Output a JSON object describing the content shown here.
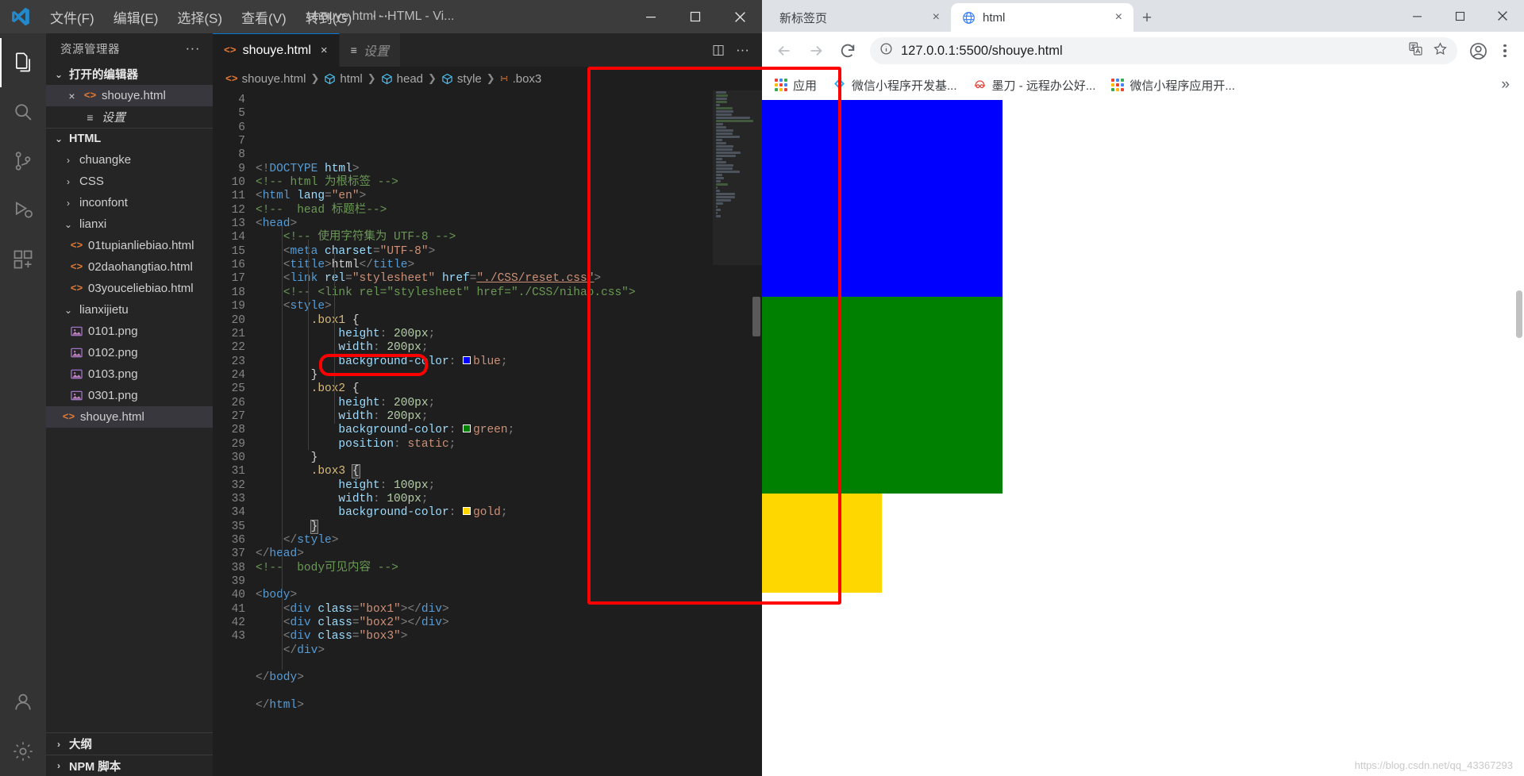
{
  "vscode": {
    "window_title": "shouye.html - HTML - Vi...",
    "menu": [
      "文件(F)",
      "编辑(E)",
      "选择(S)",
      "查看(V)",
      "转到(G)"
    ],
    "menu_overflow": "···",
    "window_buttons": {
      "minimize": "minimize",
      "maximize": "maximize",
      "close": "close"
    },
    "activity_bar": [
      {
        "name": "explorer",
        "icon": "files-icon",
        "active": true
      },
      {
        "name": "search",
        "icon": "search-icon",
        "active": false
      },
      {
        "name": "source-control",
        "icon": "source-control-icon",
        "active": false
      },
      {
        "name": "run-debug",
        "icon": "run-debug-icon",
        "active": false
      },
      {
        "name": "extensions",
        "icon": "extensions-icon",
        "active": false
      },
      {
        "name": "accounts",
        "icon": "account-icon",
        "active": false
      },
      {
        "name": "settings",
        "icon": "gear-icon",
        "active": false
      }
    ],
    "sidebar": {
      "header": "资源管理器",
      "header_more": "···",
      "open_editors": {
        "label": "打开的编辑器",
        "chevron": "⌄",
        "items": [
          {
            "label": "shouye.html",
            "icon": "html-file-icon",
            "close": "×",
            "selected": true,
            "italic": false
          },
          {
            "label": "设置",
            "icon": "settings-editor-icon",
            "close": "",
            "selected": false,
            "italic": true
          }
        ]
      },
      "project": {
        "label": "HTML",
        "chevron": "⌄",
        "items": [
          {
            "label": "chuangke",
            "type": "folder",
            "chevron": "›",
            "depth": 1,
            "selected": false
          },
          {
            "label": "CSS",
            "type": "folder",
            "chevron": "›",
            "depth": 1,
            "selected": false
          },
          {
            "label": "inconfont",
            "type": "folder",
            "chevron": "›",
            "depth": 1,
            "selected": false
          },
          {
            "label": "lianxi",
            "type": "folder",
            "chevron": "⌄",
            "depth": 1,
            "selected": false
          },
          {
            "label": "01tupianliebiao.html",
            "type": "html",
            "chevron": "",
            "depth": 2,
            "selected": false
          },
          {
            "label": "02daohangtiao.html",
            "type": "html",
            "chevron": "",
            "depth": 2,
            "selected": false
          },
          {
            "label": "03youceliebiao.html",
            "type": "html",
            "chevron": "",
            "depth": 2,
            "selected": false
          },
          {
            "label": "lianxijietu",
            "type": "folder",
            "chevron": "⌄",
            "depth": 1,
            "selected": false
          },
          {
            "label": "0101.png",
            "type": "png",
            "chevron": "",
            "depth": 2,
            "selected": false
          },
          {
            "label": "0102.png",
            "type": "png",
            "chevron": "",
            "depth": 2,
            "selected": false
          },
          {
            "label": "0103.png",
            "type": "png",
            "chevron": "",
            "depth": 2,
            "selected": false
          },
          {
            "label": "0301.png",
            "type": "png",
            "chevron": "",
            "depth": 2,
            "selected": false
          },
          {
            "label": "shouye.html",
            "type": "html",
            "chevron": "",
            "depth": 1,
            "selected": true
          }
        ]
      },
      "bottom_sections": [
        {
          "label": "大纲",
          "chevron": "›"
        },
        {
          "label": "NPM 脚本",
          "chevron": "›"
        }
      ]
    },
    "tabs": [
      {
        "label": "shouye.html",
        "icon": "html-file-icon",
        "active": true,
        "close": "×",
        "italic": false
      },
      {
        "label": "设置",
        "icon": "settings-editor-icon",
        "active": false,
        "close": "",
        "italic": true
      }
    ],
    "tab_actions": [
      {
        "name": "split-editor-icon",
        "glyph": "◫"
      },
      {
        "name": "more-actions-icon",
        "glyph": "···"
      }
    ],
    "breadcrumb": [
      {
        "label": "shouye.html",
        "icon": "html-file-icon"
      },
      {
        "label": "html",
        "icon": "cube-icon"
      },
      {
        "label": "head",
        "icon": "cube-icon"
      },
      {
        "label": "style",
        "icon": "cube-icon"
      },
      {
        "label": ".box3",
        "icon": "css-rule-icon"
      }
    ],
    "code": {
      "first_line_number": 4,
      "lines": [
        {
          "n": 4,
          "html": "<span class=\"punc\">&lt;!</span><span class=\"tagname\">DOCTYPE</span> <span class=\"attr\">html</span><span class=\"punc\">&gt;</span>"
        },
        {
          "n": 5,
          "html": "<span class=\"cmt\">&lt;!-- html 为根标签 --&gt;</span>"
        },
        {
          "n": 6,
          "html": "<span class=\"punc\">&lt;</span><span class=\"tagname\">html</span> <span class=\"attr\">lang</span><span class=\"punc\">=</span><span class=\"str\">\"en\"</span><span class=\"punc\">&gt;</span>"
        },
        {
          "n": 7,
          "html": "<span class=\"cmt\">&lt;!--  head 标题栏--&gt;</span>"
        },
        {
          "n": 8,
          "html": "<span class=\"punc\">&lt;</span><span class=\"tagname\">head</span><span class=\"punc\">&gt;</span>"
        },
        {
          "n": 9,
          "html": "    <span class=\"cmt\">&lt;!-- 使用字符集为 UTF-8 --&gt;</span>"
        },
        {
          "n": 10,
          "html": "    <span class=\"punc\">&lt;</span><span class=\"tagname\">meta</span> <span class=\"attr\">charset</span><span class=\"punc\">=</span><span class=\"str\">\"UTF-8\"</span><span class=\"punc\">&gt;</span>"
        },
        {
          "n": 11,
          "html": "    <span class=\"punc\">&lt;</span><span class=\"tagname\">title</span><span class=\"punc\">&gt;</span><span class=\"txt\">html</span><span class=\"punc\">&lt;/</span><span class=\"tagname\">title</span><span class=\"punc\">&gt;</span>"
        },
        {
          "n": 12,
          "html": "    <span class=\"punc\">&lt;</span><span class=\"tagname\">link</span> <span class=\"attr\">rel</span><span class=\"punc\">=</span><span class=\"str\">\"stylesheet\"</span> <span class=\"attr\">href</span><span class=\"punc\">=</span><span class=\"str under\">\"./CSS/reset.css\"</span><span class=\"punc\">&gt;</span>"
        },
        {
          "n": 13,
          "html": "    <span class=\"cmt\">&lt;!-- &lt;link rel=\"stylesheet\" href=\"./CSS/nihao.css\"&gt;</span>"
        },
        {
          "n": 14,
          "html": "    <span class=\"punc\">&lt;</span><span class=\"tagname\">style</span><span class=\"punc\">&gt;</span>"
        },
        {
          "n": 15,
          "html": "        <span class=\"sel\">.box1</span> <span class=\"brace\">{</span>"
        },
        {
          "n": 16,
          "html": "            <span class=\"prop\">height</span><span class=\"punc\">:</span> <span class=\"num\">200px</span><span class=\"punc\">;</span>"
        },
        {
          "n": 17,
          "html": "            <span class=\"prop\">width</span><span class=\"punc\">:</span> <span class=\"num\">200px</span><span class=\"punc\">;</span>"
        },
        {
          "n": 18,
          "html": "            <span class=\"prop\">background-color</span><span class=\"punc\">:</span> <span class=\"swatch\" style=\"background:#0000ff\"></span><span class=\"val\">blue</span><span class=\"punc\">;</span>"
        },
        {
          "n": 19,
          "html": "        <span class=\"brace\">}</span>"
        },
        {
          "n": 20,
          "html": "        <span class=\"sel\">.box2</span> <span class=\"brace\">{</span>"
        },
        {
          "n": 21,
          "html": "            <span class=\"prop\">height</span><span class=\"punc\">:</span> <span class=\"num\">200px</span><span class=\"punc\">;</span>"
        },
        {
          "n": 22,
          "html": "            <span class=\"prop\">width</span><span class=\"punc\">:</span> <span class=\"num\">200px</span><span class=\"punc\">;</span>"
        },
        {
          "n": 23,
          "html": "            <span class=\"prop\">background-color</span><span class=\"punc\">:</span> <span class=\"swatch\" style=\"background:#008000\"></span><span class=\"val\">green</span><span class=\"punc\">;</span>"
        },
        {
          "n": 24,
          "html": "            <span class=\"prop\">position</span><span class=\"punc\">:</span> <span class=\"val\">static</span><span class=\"punc\">;</span>"
        },
        {
          "n": 25,
          "html": "        <span class=\"brace\">}</span>"
        },
        {
          "n": 26,
          "html": "        <span class=\"sel\">.box3</span> <span class=\"brace bracket-hl\">{</span>"
        },
        {
          "n": 27,
          "html": "            <span class=\"prop\">height</span><span class=\"punc\">:</span> <span class=\"num\">100px</span><span class=\"punc\">;</span>"
        },
        {
          "n": 28,
          "html": "            <span class=\"prop\">width</span><span class=\"punc\">:</span> <span class=\"num\">100px</span><span class=\"punc\">;</span>"
        },
        {
          "n": 29,
          "html": "            <span class=\"prop\">background-color</span><span class=\"punc\">:</span> <span class=\"swatch\" style=\"background:#ffd700\"></span><span class=\"val\">gold</span><span class=\"punc\">;</span>"
        },
        {
          "n": 30,
          "html": "        <span class=\"brace bracket-hl\">}</span>"
        },
        {
          "n": 31,
          "html": "    <span class=\"punc\">&lt;/</span><span class=\"tagname\">style</span><span class=\"punc\">&gt;</span>"
        },
        {
          "n": 32,
          "html": "<span class=\"punc\">&lt;/</span><span class=\"tagname\">head</span><span class=\"punc\">&gt;</span>"
        },
        {
          "n": 33,
          "html": "<span class=\"cmt\">&lt;!--  body可见内容 --&gt;</span>"
        },
        {
          "n": 34,
          "html": ""
        },
        {
          "n": 35,
          "html": "<span class=\"punc\">&lt;</span><span class=\"tagname\">body</span><span class=\"punc\">&gt;</span>"
        },
        {
          "n": 36,
          "html": "    <span class=\"punc\">&lt;</span><span class=\"tagname\">div</span> <span class=\"attr\">class</span><span class=\"punc\">=</span><span class=\"str\">\"box1\"</span><span class=\"punc\">&gt;&lt;/</span><span class=\"tagname\">div</span><span class=\"punc\">&gt;</span>"
        },
        {
          "n": 37,
          "html": "    <span class=\"punc\">&lt;</span><span class=\"tagname\">div</span> <span class=\"attr\">class</span><span class=\"punc\">=</span><span class=\"str\">\"box2\"</span><span class=\"punc\">&gt;&lt;/</span><span class=\"tagname\">div</span><span class=\"punc\">&gt;</span>"
        },
        {
          "n": 38,
          "html": "    <span class=\"punc\">&lt;</span><span class=\"tagname\">div</span> <span class=\"attr\">class</span><span class=\"punc\">=</span><span class=\"str\">\"box3\"</span><span class=\"punc\">&gt;</span>"
        },
        {
          "n": 39,
          "html": "    <span class=\"punc\">&lt;/</span><span class=\"tagname\">div</span><span class=\"punc\">&gt;</span>"
        },
        {
          "n": 40,
          "html": ""
        },
        {
          "n": 41,
          "html": "<span class=\"punc\">&lt;/</span><span class=\"tagname\">body</span><span class=\"punc\">&gt;</span>"
        },
        {
          "n": 42,
          "html": ""
        },
        {
          "n": 43,
          "html": "<span class=\"punc\">&lt;/</span><span class=\"tagname\">html</span><span class=\"punc\">&gt;</span>"
        }
      ]
    }
  },
  "chrome": {
    "tabs": [
      {
        "label": "新标签页",
        "active": false,
        "favicon": "none",
        "close": "×"
      },
      {
        "label": "html",
        "active": true,
        "favicon": "globe-icon",
        "close": "×"
      }
    ],
    "new_tab_button": "+",
    "window_buttons": {
      "minimize": "minimize",
      "maximize": "maximize",
      "close": "close"
    },
    "toolbar": {
      "back": "←",
      "forward": "→",
      "reload": "↻",
      "site_info_icon": "info-circle-icon",
      "url": "127.0.0.1:5500/shouye.html",
      "translate_icon": "translate-icon",
      "bookmark_star_icon": "star-icon",
      "profile_icon": "profile-avatar-icon",
      "menu_icon": "kebab-menu-icon"
    },
    "bookmarks": [
      {
        "label": "应用",
        "icon": "apps-grid-icon"
      },
      {
        "label": "微信小程序开发基...",
        "icon": "wechat-devtools-icon"
      },
      {
        "label": "墨刀 - 远程办公好...",
        "icon": "modao-icon"
      },
      {
        "label": "微信小程序应用开...",
        "icon": "wechat-apps-icon"
      }
    ],
    "bookmarks_overflow": "»",
    "page": {
      "boxes": [
        {
          "name": "box1",
          "color": "#0000ff",
          "label": "blue-box"
        },
        {
          "name": "box2",
          "color": "#008000",
          "label": "green-box"
        },
        {
          "name": "box3",
          "color": "#ffd700",
          "label": "gold-box"
        }
      ]
    },
    "watermark": "https://blog.csdn.net/qq_43367293"
  },
  "annotations": [
    {
      "name": "position-static-highlight",
      "target": "code line 24 position: static;"
    },
    {
      "name": "rendered-boxes-highlight",
      "target": "browser viewport rendered boxes"
    }
  ],
  "colors": {
    "vscode_bg": "#1e1e1e",
    "vscode_sidebar": "#252526",
    "vscode_titlebar": "#3c3c3c",
    "accent_orange": "#e37933",
    "annotation_red": "#ff0000",
    "blue": "#0000ff",
    "green": "#008000",
    "gold": "#ffd700"
  }
}
